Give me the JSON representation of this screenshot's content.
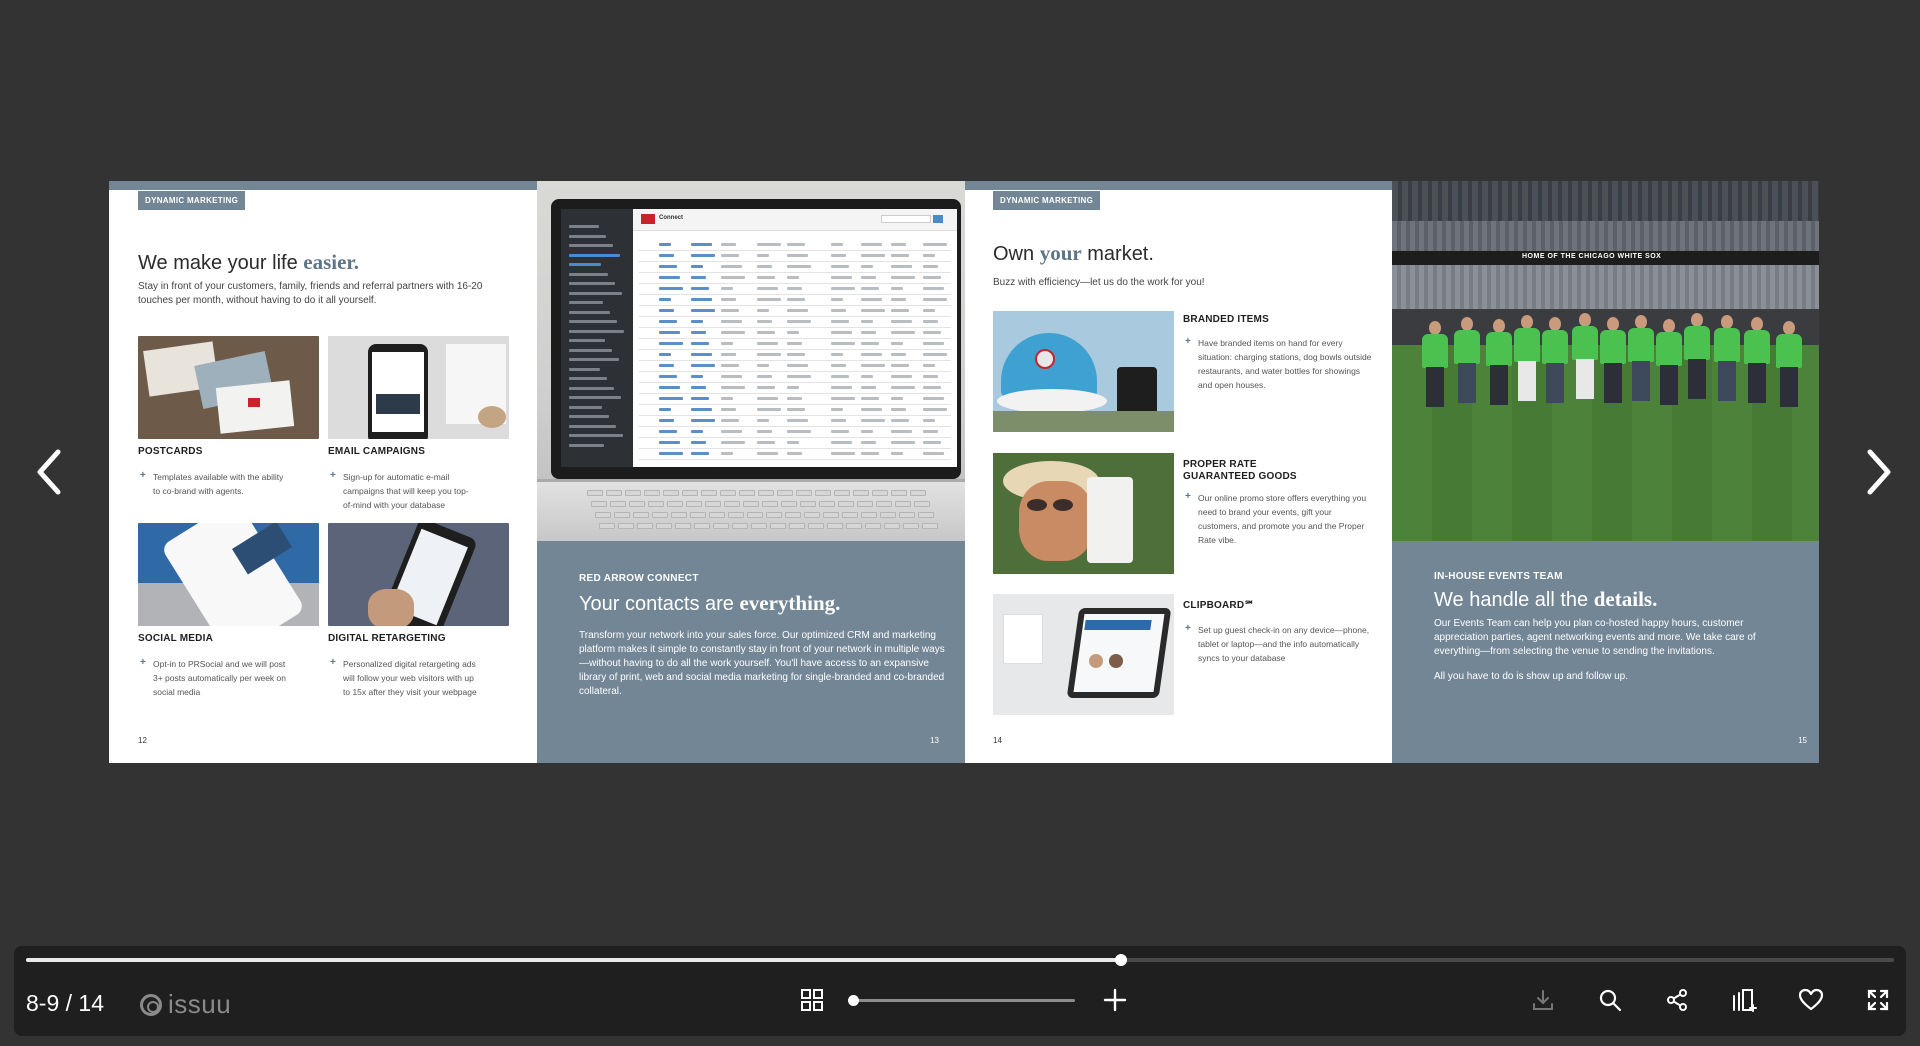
{
  "viewer": {
    "page_indicator": "8-9 / 14",
    "brand_name": "issuu",
    "progress_fraction": 0.586,
    "zoom_fraction": 0.0,
    "controls": [
      "grid-view",
      "zoom-slider",
      "zoom-in",
      "download",
      "search",
      "share",
      "add-to-stack",
      "like",
      "fullscreen"
    ]
  },
  "page12": {
    "tag": "DYNAMIC MARKETING",
    "headline_pre": "We make your life ",
    "headline_em": "easier.",
    "subtext": "Stay in front of your customers, family, friends and referral partners with 16-20 touches per month, without having to do it all yourself.",
    "cards": [
      {
        "title": "POSTCARDS",
        "body": "Templates available with the ability to co-brand with agents."
      },
      {
        "title": "EMAIL CAMPAIGNS",
        "body": "Sign-up for automatic e-mail campaigns that will keep you top-of-mind with your database"
      },
      {
        "title": "SOCIAL MEDIA",
        "body": "Opt-in to PRSocial and we will post 3+ posts automatically per week on social media"
      },
      {
        "title": "DIGITAL RETARGETING",
        "body": "Personalized digital retargeting ads will follow your web visitors with up to 15x after they visit your webpage"
      }
    ],
    "page_number": "12"
  },
  "page13": {
    "kicker": "RED ARROW CONNECT",
    "headline_pre": "Your contacts are ",
    "headline_em": "everything.",
    "body": "Transform your network into your sales force. Our optimized CRM and marketing platform makes it simple to constantly stay in front of your network in multiple ways—without having to do all the work yourself. You'll have access to an expansive library of print, web and social media marketing for single-branded and co-branded collateral.",
    "crm_logo_text": "Connect",
    "page_number": "13"
  },
  "page14": {
    "tag": "DYNAMIC MARKETING",
    "headline_pre": "Own ",
    "headline_em": "your",
    "headline_post": " market.",
    "subtext": "Buzz with efficiency—let us do the work for you!",
    "items": [
      {
        "title": "BRANDED ITEMS",
        "body": "Have branded items on hand for every situation: charging stations, dog bowls outside restaurants, and water bottles for showings and open houses."
      },
      {
        "title": "PROPER RATE\nGUARANTEED GOODS",
        "body": "Our online promo store offers everything you need to brand your events, gift your customers, and promote you and the Proper Rate vibe."
      },
      {
        "title": "CLIPBOARD℠",
        "body": "Set up guest check-in on any device—phone, tablet or laptop—and the info automatically syncs to your database"
      }
    ],
    "page_number": "14"
  },
  "page15": {
    "stadium_banner": "HOME OF THE CHICAGO WHITE SOX",
    "kicker": "IN-HOUSE EVENTS TEAM",
    "headline_pre": "We handle all the ",
    "headline_em": "details.",
    "body": "Our Events Team can help you plan co-hosted happy hours, customer appreciation parties, agent networking events and more. We take care of everything—from selecting the venue to sending the invitations.",
    "body2": "All you have to do is show up and follow up.",
    "page_number": "15"
  },
  "colors": {
    "accent": "#728696",
    "background": "#333333",
    "bar": "#1f1f1f"
  }
}
